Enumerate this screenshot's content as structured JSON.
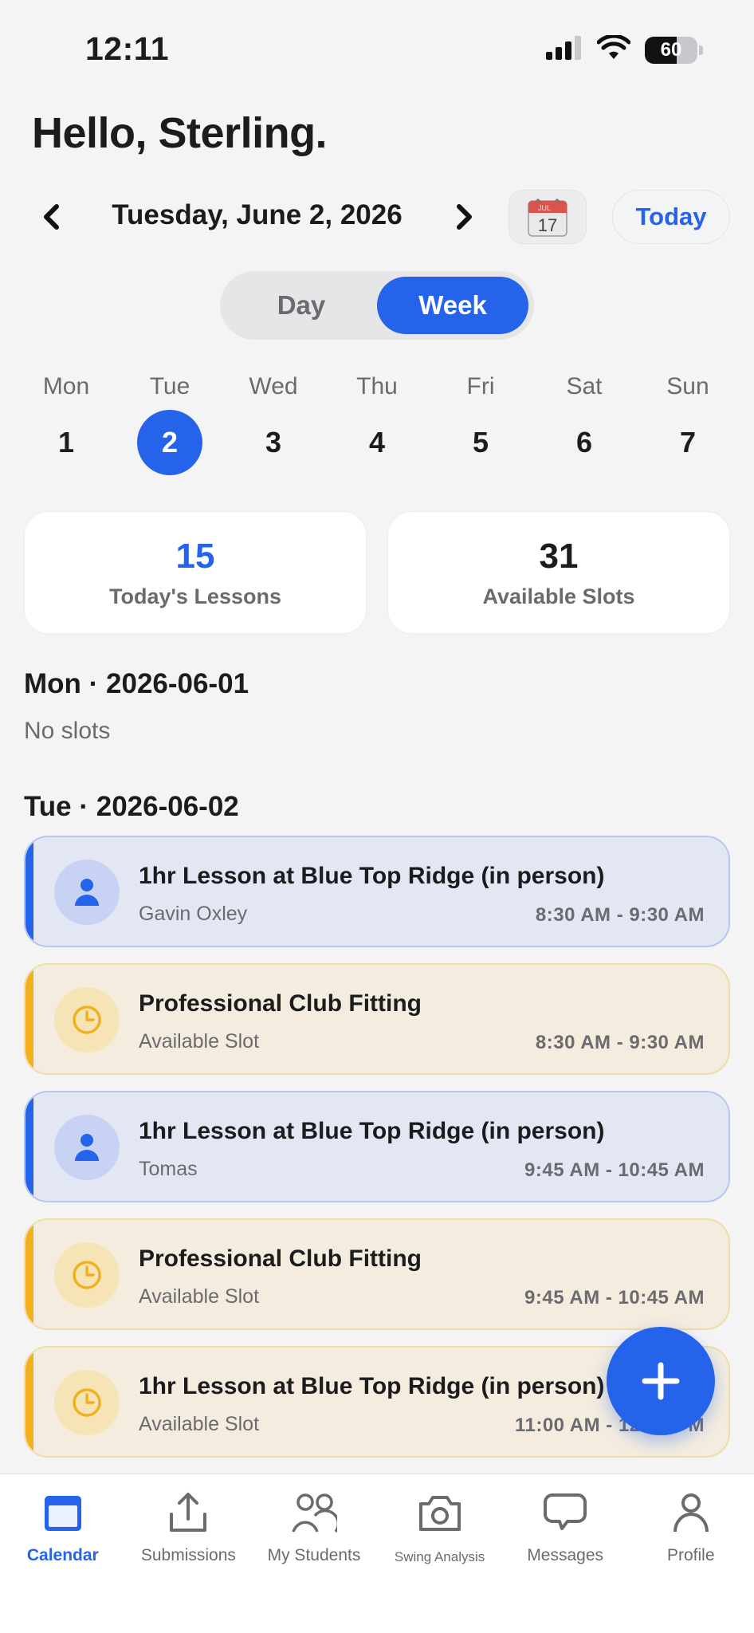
{
  "status_bar": {
    "time": "12:11",
    "battery": "60",
    "battery_level": 0.6
  },
  "greeting": "Hello, Sterling.",
  "date_nav": {
    "date": "Tuesday, June 2, 2026",
    "calendar_icon_month": "JUL",
    "calendar_icon_day": "17",
    "today_label": "Today"
  },
  "view_toggle": {
    "options": [
      "Day",
      "Week"
    ],
    "selected": "Week"
  },
  "week": {
    "days": [
      {
        "name": "Mon",
        "num": "1"
      },
      {
        "name": "Tue",
        "num": "2",
        "selected": true
      },
      {
        "name": "Wed",
        "num": "3"
      },
      {
        "name": "Thu",
        "num": "4"
      },
      {
        "name": "Fri",
        "num": "5"
      },
      {
        "name": "Sat",
        "num": "6"
      },
      {
        "name": "Sun",
        "num": "7"
      }
    ]
  },
  "stats": {
    "lessons": {
      "value": "15",
      "label": "Today's Lessons"
    },
    "slots": {
      "value": "31",
      "label": "Available Slots"
    }
  },
  "sections": {
    "mon": {
      "header": "Mon · 2026-06-01",
      "empty": "No slots"
    },
    "tue": {
      "header": "Tue · 2026-06-02"
    }
  },
  "slots": [
    {
      "kind": "booked",
      "icon": "person-icon",
      "title": "1hr Lesson at Blue Top Ridge (in person)",
      "sub": "Gavin Oxley",
      "time": "8:30 AM - 9:30 AM"
    },
    {
      "kind": "open",
      "icon": "clock-icon",
      "title": "Professional Club Fitting",
      "sub": "Available Slot",
      "time": "8:30 AM - 9:30 AM"
    },
    {
      "kind": "booked",
      "icon": "person-icon",
      "title": "1hr Lesson at Blue Top Ridge (in person)",
      "sub": "Tomas",
      "time": "9:45 AM - 10:45 AM"
    },
    {
      "kind": "open",
      "icon": "clock-icon",
      "title": "Professional Club Fitting",
      "sub": "Available Slot",
      "time": "9:45 AM - 10:45 AM"
    },
    {
      "kind": "open",
      "icon": "clock-icon",
      "title": "1hr Lesson at Blue Top Ridge (in person)",
      "sub": "Available Slot",
      "time": "11:00 AM - 12:00 PM"
    }
  ],
  "tabs": [
    {
      "label": "Calendar",
      "icon": "calendar-icon",
      "active": true
    },
    {
      "label": "Submissions",
      "icon": "upload-icon"
    },
    {
      "label": "My Students",
      "icon": "students-icon"
    },
    {
      "label": "Swing Analysis",
      "icon": "camera-icon"
    },
    {
      "label": "Messages",
      "icon": "message-icon"
    },
    {
      "label": "Profile",
      "icon": "profile-icon"
    }
  ],
  "colors": {
    "accent": "#2563eb",
    "available": "#f2b01e",
    "background": "#f4f4f5"
  }
}
